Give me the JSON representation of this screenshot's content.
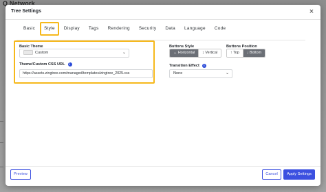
{
  "background": {
    "header_text": "Q Network"
  },
  "modal": {
    "title": "Tree Settings",
    "close_glyph": "×"
  },
  "tabs": [
    {
      "label": "Basic",
      "active": false
    },
    {
      "label": "Style",
      "active": true
    },
    {
      "label": "Display",
      "active": false
    },
    {
      "label": "Tags",
      "active": false
    },
    {
      "label": "Rendering",
      "active": false
    },
    {
      "label": "Security",
      "active": false
    },
    {
      "label": "Data",
      "active": false
    },
    {
      "label": "Language",
      "active": false
    },
    {
      "label": "Code",
      "active": false
    }
  ],
  "basic_theme": {
    "label": "Basic Theme",
    "value": "Custom",
    "chevron": "⌄"
  },
  "css_url": {
    "label": "Theme/Custom CSS URL",
    "value": "https://assets.zingtree.com/managed/templates/zingtree_2025.css"
  },
  "buttons_style": {
    "label": "Buttons Style",
    "options": [
      {
        "label": "↔ Horizontal",
        "selected": true
      },
      {
        "label": "↕ Vertical",
        "selected": false
      }
    ]
  },
  "buttons_position": {
    "label": "Buttons Position",
    "options": [
      {
        "label": "↑ Top",
        "selected": false
      },
      {
        "label": "↓ Bottom",
        "selected": true
      }
    ]
  },
  "transition_effect": {
    "label": "Transition Effect",
    "value": "None",
    "chevron": "⌄"
  },
  "footer": {
    "preview_label": "Preview",
    "cancel_label": "Cancel",
    "apply_label": "Apply Settings"
  },
  "colors": {
    "accent": "#3c50e0",
    "highlight": "#f6b81a",
    "segment_selected": "#6b6f76"
  }
}
